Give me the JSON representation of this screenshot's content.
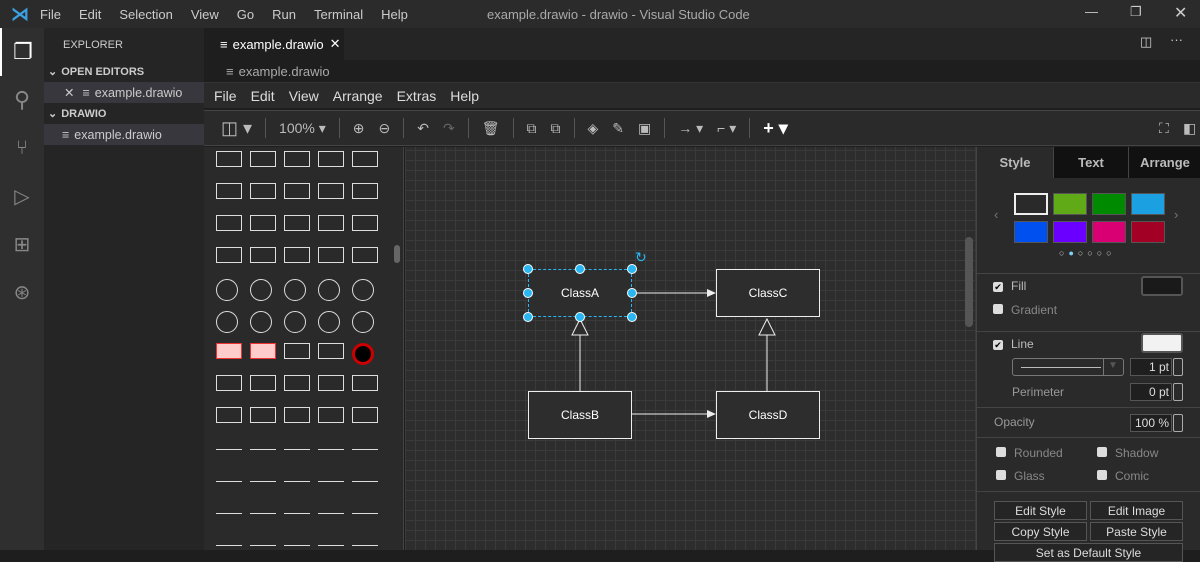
{
  "window": {
    "title": "example.drawio - drawio - Visual Studio Code",
    "menu": [
      "File",
      "Edit",
      "Selection",
      "View",
      "Go",
      "Run",
      "Terminal",
      "Help"
    ]
  },
  "sidebar": {
    "title": "EXPLORER",
    "open_editors": "OPEN EDITORS",
    "open_file": "example.drawio",
    "folder": "DRAWIO",
    "folder_file": "example.drawio"
  },
  "editor": {
    "tab": "example.drawio",
    "breadcrumb": "example.drawio"
  },
  "drawio": {
    "menu": [
      "File",
      "Edit",
      "View",
      "Arrange",
      "Extras",
      "Help"
    ],
    "zoom": "100%",
    "nodes": {
      "a": "ClassA",
      "b": "ClassB",
      "c": "ClassC",
      "d": "ClassD"
    },
    "panel": {
      "tabs": [
        "Style",
        "Text",
        "Arrange"
      ],
      "swatches": [
        "#2a2a2a",
        "#60a917",
        "#008a00",
        "#1ba1e2",
        "#0050ef",
        "#6a00ff",
        "#d80073",
        "#a20025"
      ],
      "fill": "Fill",
      "gradient": "Gradient",
      "line": "Line",
      "line_width": "1 pt",
      "perimeter": "Perimeter",
      "perimeter_value": "0 pt",
      "opacity": "Opacity",
      "opacity_value": "100 %",
      "rounded": "Rounded",
      "shadow": "Shadow",
      "glass": "Glass",
      "comic": "Comic",
      "edit_style": "Edit Style",
      "edit_image": "Edit Image",
      "copy_style": "Copy Style",
      "paste_style": "Paste Style",
      "set_default": "Set as Default Style"
    }
  }
}
